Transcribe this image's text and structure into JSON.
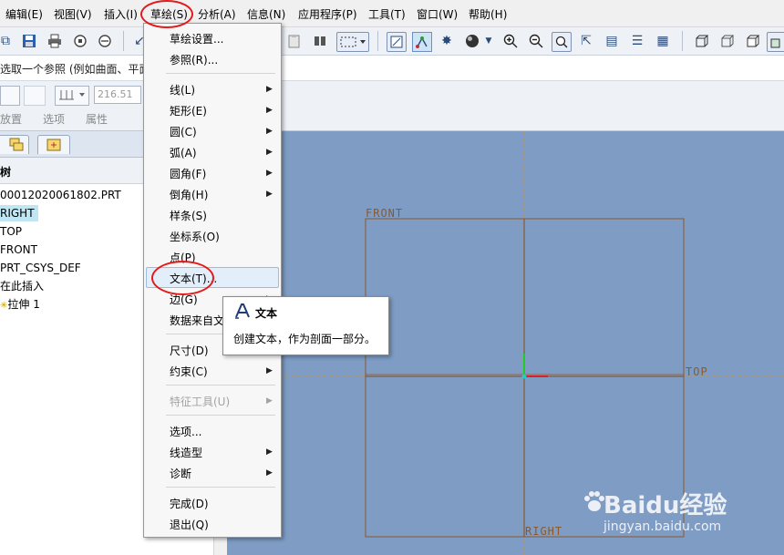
{
  "menubar": {
    "items": [
      "编辑(E)",
      "视图(V)",
      "插入(I)",
      "草绘(S)",
      "分析(A)",
      "信息(N)",
      "应用程序(P)",
      "工具(T)",
      "窗口(W)",
      "帮助(H)"
    ]
  },
  "message_bar": {
    "text": "选取一个参照 (例如曲面、平面或"
  },
  "dashboard": {
    "depth_value": "216.51",
    "tabs": [
      "放置",
      "选项",
      "属性"
    ]
  },
  "model_tree": {
    "header": "树",
    "items": [
      "00012020061802.PRT",
      "RIGHT",
      "TOP",
      "FRONT",
      "PRT_CSYS_DEF",
      "在此插入",
      "拉伸 1"
    ]
  },
  "sketch_menu": {
    "items": [
      {
        "label": "草绘设置...",
        "submenu": false
      },
      {
        "label": "参照(R)...",
        "submenu": false
      },
      {
        "label": "线(L)",
        "submenu": true
      },
      {
        "label": "矩形(E)",
        "submenu": true
      },
      {
        "label": "圆(C)",
        "submenu": true
      },
      {
        "label": "弧(A)",
        "submenu": true
      },
      {
        "label": "圆角(F)",
        "submenu": true
      },
      {
        "label": "倒角(H)",
        "submenu": true
      },
      {
        "label": "样条(S)",
        "submenu": false
      },
      {
        "label": "坐标系(O)",
        "submenu": false
      },
      {
        "label": "点(P)",
        "submenu": false
      },
      {
        "label": "文本(T)...",
        "submenu": false,
        "highlighted": true
      },
      {
        "label": "边(G)",
        "submenu": true
      },
      {
        "label": "数据来自文",
        "submenu": false
      },
      {
        "label": "尺寸(D)",
        "submenu": false
      },
      {
        "label": "约束(C)",
        "submenu": true
      },
      {
        "label": "特征工具(U)",
        "submenu": true,
        "disabled": true
      },
      {
        "label": "选项...",
        "submenu": false
      },
      {
        "label": "线造型",
        "submenu": true
      },
      {
        "label": "诊断",
        "submenu": true
      },
      {
        "label": "完成(D)",
        "submenu": false
      },
      {
        "label": "退出(Q)",
        "submenu": false
      }
    ]
  },
  "tooltip": {
    "title": "文本",
    "description": "创建文本，作为剖面一部分。"
  },
  "graphics": {
    "datum_labels": {
      "front": "FRONT",
      "top": "TOP",
      "right": "RIGHT"
    }
  },
  "watermark": {
    "main": "Baidu经验",
    "sub": "jingyan.baidu.com"
  },
  "colors": {
    "graphics_bg": "#7e9cc4",
    "datum_plane": "#8a5a2e",
    "annotation_circle": "#e41a1a",
    "highlight": "#bfe6f2"
  }
}
